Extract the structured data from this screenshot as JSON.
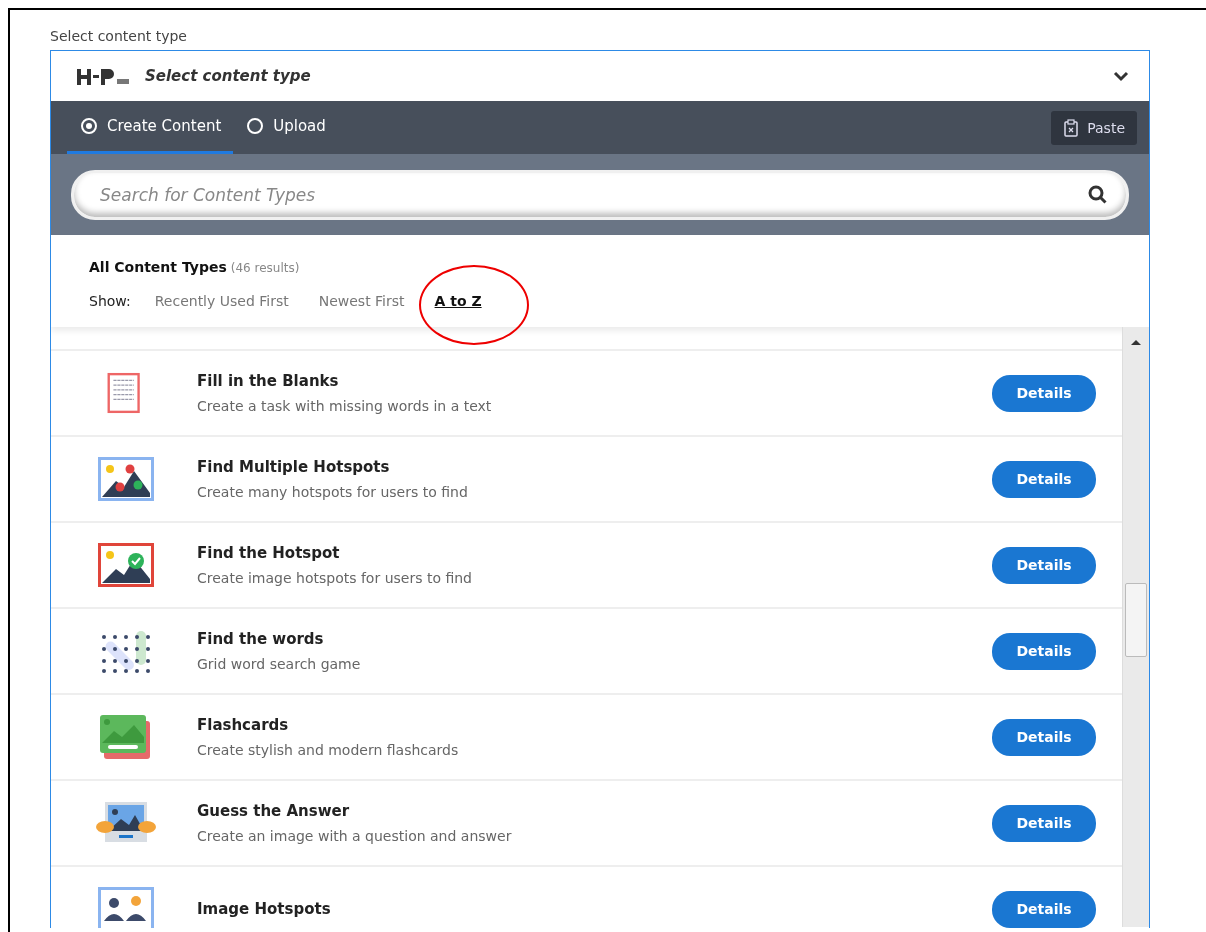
{
  "field_label": "Select content type",
  "header": {
    "title": "Select content type"
  },
  "tabs": [
    {
      "label": "Create Content",
      "selected": true
    },
    {
      "label": "Upload",
      "selected": false
    }
  ],
  "paste_button": "Paste",
  "search": {
    "placeholder": "Search for Content Types"
  },
  "results": {
    "title": "All Content Types",
    "count": "(46 results)"
  },
  "sort": {
    "label": "Show:",
    "options": [
      {
        "label": "Recently Used First",
        "selected": false
      },
      {
        "label": "Newest First",
        "selected": false
      },
      {
        "label": "A to Z",
        "selected": true
      }
    ]
  },
  "items": [
    {
      "title": "Fill in the Blanks",
      "description": "Create a task with missing words in a text",
      "button": "Details"
    },
    {
      "title": "Find Multiple Hotspots",
      "description": "Create many hotspots for users to find",
      "button": "Details"
    },
    {
      "title": "Find the Hotspot",
      "description": "Create image hotspots for users to find",
      "button": "Details"
    },
    {
      "title": "Find the words",
      "description": "Grid word search game",
      "button": "Details"
    },
    {
      "title": "Flashcards",
      "description": "Create stylish and modern flashcards",
      "button": "Details"
    },
    {
      "title": "Guess the Answer",
      "description": "Create an image with a question and answer",
      "button": "Details"
    },
    {
      "title": "Image Hotspots",
      "button": "Details"
    }
  ]
}
